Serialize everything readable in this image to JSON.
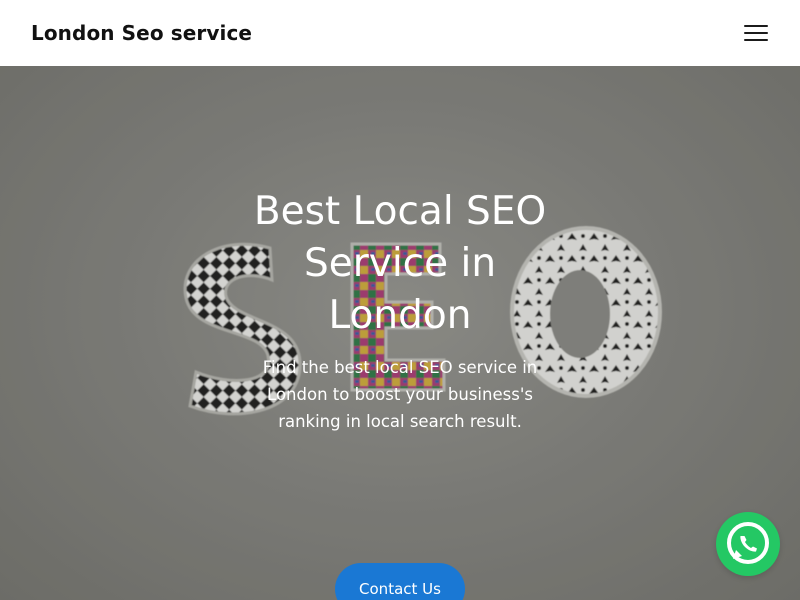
{
  "header": {
    "brand": "London Seo service",
    "menu_icon": "hamburger-menu-icon"
  },
  "hero": {
    "title": "Best Local SEO Service in London",
    "description": "Find the best local SEO service in London to boost your business's ranking in local search result.",
    "cta_label": "Contact Us",
    "background_letters": [
      "S",
      "E",
      "O"
    ],
    "background_image": "decorative-seo-letters-photo"
  },
  "floating": {
    "whatsapp_icon": "whatsapp-icon"
  },
  "colors": {
    "cta": "#1a78d4",
    "whatsapp": "#24c864",
    "brand_text": "#111111",
    "hero_text": "#ffffff"
  }
}
